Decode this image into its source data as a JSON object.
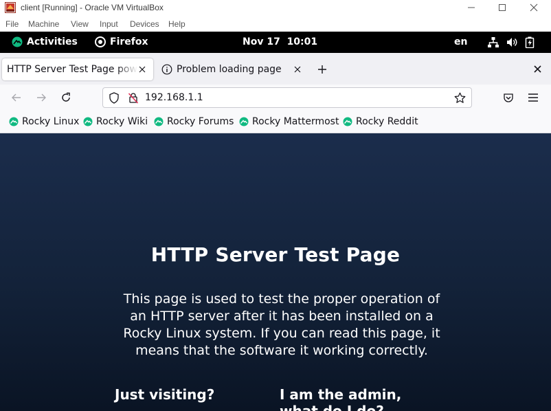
{
  "vbox": {
    "title": "client [Running] - Oracle VM VirtualBox",
    "menu": [
      "File",
      "Machine",
      "View",
      "Input",
      "Devices",
      "Help"
    ]
  },
  "gnome": {
    "activities": "Activities",
    "app": "Firefox",
    "clock": "Nov 17  10:01",
    "lang": "en"
  },
  "tabs": [
    {
      "label": "HTTP Server Test Page powered by Rocky Linux",
      "active": true
    },
    {
      "label": "Problem loading page",
      "active": false
    }
  ],
  "urlbar": {
    "value": "192.168.1.1"
  },
  "bookmarks": [
    "Rocky Linux",
    "Rocky Wiki",
    "Rocky Forums",
    "Rocky Mattermost",
    "Rocky Reddit"
  ],
  "page": {
    "heading_light": "HTTP Server",
    "heading_bold": "Test Page",
    "lead": "This page is used to test the proper operation of an HTTP server after it has been installed on a Rocky Linux system. If you can read this page, it means that the software it working correctly.",
    "col1_heading": "Just visiting?",
    "col2_heading": "I am the admin, what do I do?"
  },
  "colors": {
    "rocky_green": "#10b981",
    "page_bg_top": "#1b2d4c",
    "page_bg_bottom": "#0a1424"
  }
}
